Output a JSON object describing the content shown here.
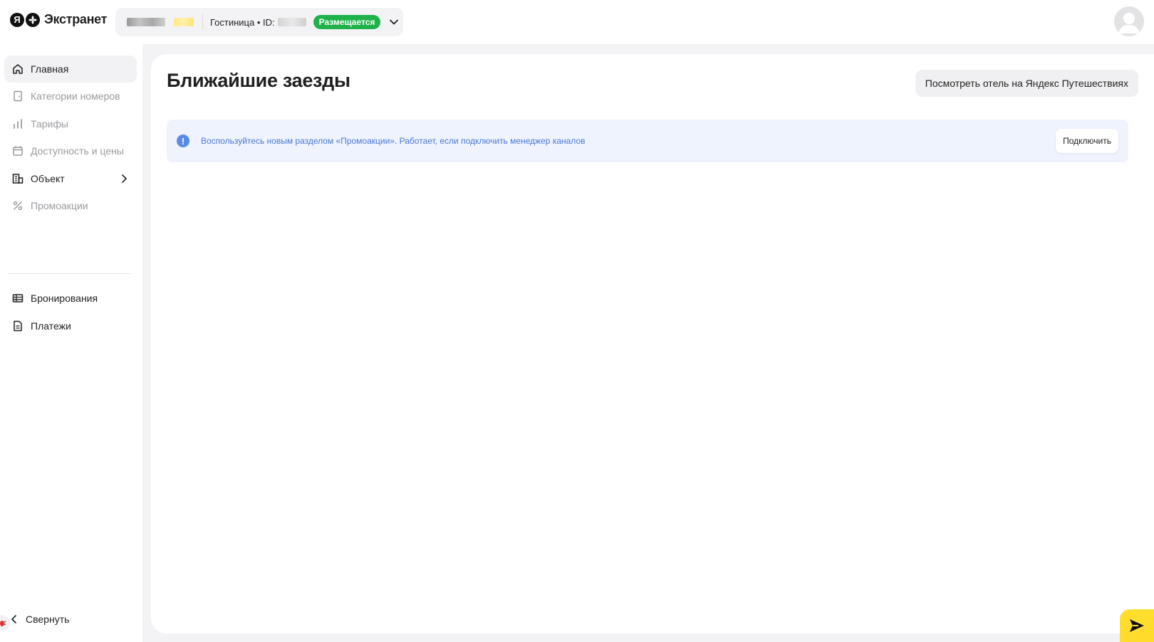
{
  "header": {
    "logo_letter": "Я",
    "brand": "Экстранет",
    "hotel_type": "Гостиница",
    "id_separator": " • ID:",
    "status": "Размещается"
  },
  "sidebar": {
    "items": [
      {
        "label": "Главная",
        "icon": "home-icon",
        "active": true
      },
      {
        "label": "Категории номеров",
        "icon": "door-icon",
        "disabled": true
      },
      {
        "label": "Тарифы",
        "icon": "bar-chart-icon",
        "disabled": true
      },
      {
        "label": "Доступность и цены",
        "icon": "calendar-icon",
        "disabled": true
      },
      {
        "label": "Объект",
        "icon": "building-icon",
        "has_submenu": true
      },
      {
        "label": "Промоакции",
        "icon": "percent-icon",
        "disabled": true
      },
      {
        "label": "Бронирования",
        "icon": "table-icon"
      },
      {
        "label": "Платежи",
        "icon": "document-icon"
      }
    ],
    "collapse_label": "Свернуть"
  },
  "main": {
    "title": "Ближайшие заезды",
    "view_button": "Посмотреть отель на Яндекс Путешествиях",
    "banner": {
      "icon": "!",
      "text": "Воспользуйтесь новым разделом «Промоакции». Работает, если подключить менеджер каналов",
      "button": "Подключить"
    }
  },
  "colors": {
    "accent_yellow": "#ffdd2d",
    "status_green": "#1fb24a",
    "info_blue": "#5b8be6",
    "banner_bg": "#eef3fd"
  }
}
